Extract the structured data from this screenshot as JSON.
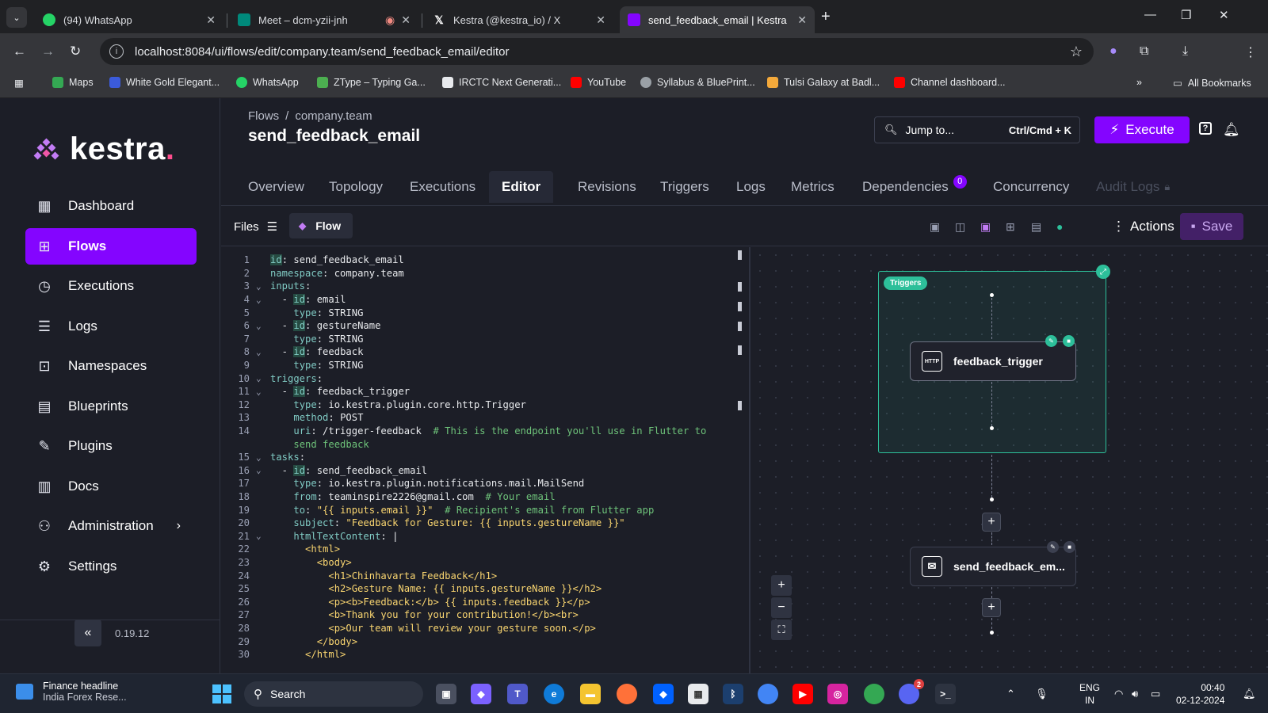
{
  "browser": {
    "tabs": [
      {
        "title": "(94) WhatsApp",
        "icon": "whatsapp-icon",
        "color": "#25d366"
      },
      {
        "title": "Meet – dcm-yzii-jnh",
        "icon": "google-meet-icon",
        "color": "#00897b"
      },
      {
        "title": "Kestra (@kestra_io) / X",
        "icon": "x-icon",
        "color": "#000000"
      },
      {
        "title": "send_feedback_email | Kestra",
        "icon": "kestra-icon",
        "color": "#8405ff"
      }
    ],
    "url": "localhost:8084/ui/flows/edit/company.team/send_feedback_email/editor",
    "bookmarks": [
      {
        "label": "Maps",
        "color": "#34a853"
      },
      {
        "label": "White Gold Elegant...",
        "color": "#3b5bdb"
      },
      {
        "label": "WhatsApp",
        "color": "#25d366"
      },
      {
        "label": "ZType – Typing Ga...",
        "color": "#4caf50"
      },
      {
        "label": "IRCTC Next Generati...",
        "color": "#e8eaed"
      },
      {
        "label": "YouTube",
        "color": "#ff0000"
      },
      {
        "label": "Syllabus & BluePrint...",
        "color": "#9aa0a6"
      },
      {
        "label": "Tulsi Galaxy at Badl...",
        "color": "#f4a93b"
      },
      {
        "label": "Channel dashboard...",
        "color": "#ff0000"
      }
    ],
    "all_bookmarks": "All Bookmarks"
  },
  "app": {
    "brand": "kestra",
    "brand_dot": ".",
    "nav": [
      {
        "label": "Dashboard",
        "icon": "dashboard-icon",
        "glyph": "▦",
        "active": false
      },
      {
        "label": "Flows",
        "icon": "flows-icon",
        "glyph": "⊞",
        "active": true
      },
      {
        "label": "Executions",
        "icon": "executions-icon",
        "glyph": "◷",
        "active": false
      },
      {
        "label": "Logs",
        "icon": "logs-icon",
        "glyph": "☰",
        "active": false
      },
      {
        "label": "Namespaces",
        "icon": "namespaces-icon",
        "glyph": "⊡",
        "active": false
      },
      {
        "label": "Blueprints",
        "icon": "blueprints-icon",
        "glyph": "▤",
        "active": false
      },
      {
        "label": "Plugins",
        "icon": "plugins-icon",
        "glyph": "✎",
        "active": false
      },
      {
        "label": "Docs",
        "icon": "docs-icon",
        "glyph": "▥",
        "active": false
      },
      {
        "label": "Administration",
        "icon": "administration-icon",
        "glyph": "⚇",
        "active": false,
        "chevron": "›"
      },
      {
        "label": "Settings",
        "icon": "settings-icon",
        "glyph": "⚙",
        "active": false
      }
    ],
    "collapse_label": "«",
    "version": "0.19.12"
  },
  "header": {
    "breadcrumb": [
      "Flows",
      "/",
      "company.team"
    ],
    "title": "send_feedback_email",
    "jump_label": "Jump to...",
    "jump_shortcut": "Ctrl/Cmd + K",
    "execute_label": "Execute"
  },
  "tabs": [
    {
      "label": "Overview",
      "state": "normal"
    },
    {
      "label": "Topology",
      "state": "normal"
    },
    {
      "label": "Executions",
      "state": "normal"
    },
    {
      "label": "Editor",
      "state": "active"
    },
    {
      "label": "Revisions",
      "state": "normal"
    },
    {
      "label": "Triggers",
      "state": "normal"
    },
    {
      "label": "Logs",
      "state": "normal"
    },
    {
      "label": "Metrics",
      "state": "normal"
    },
    {
      "label": "Dependencies",
      "state": "normal",
      "badge": "0"
    },
    {
      "label": "Concurrency",
      "state": "normal"
    },
    {
      "label": "Audit Logs",
      "state": "disabled"
    }
  ],
  "editor_toolbar": {
    "files_label": "Files",
    "flow_label": "Flow",
    "actions_label": "Actions",
    "save_label": "Save"
  },
  "code": [
    {
      "n": "1",
      "fold": "",
      "parts": [
        [
          "kid",
          "id"
        ],
        [
          "v",
          ": send_feedback_email"
        ]
      ]
    },
    {
      "n": "2",
      "fold": "",
      "parts": [
        [
          "k",
          "namespace"
        ],
        [
          "v",
          ": company.team"
        ]
      ]
    },
    {
      "n": "3",
      "fold": "⌄",
      "parts": [
        [
          "k",
          "inputs"
        ],
        [
          "v",
          ":"
        ]
      ]
    },
    {
      "n": "4",
      "fold": "⌄",
      "parts": [
        [
          "v",
          "  - "
        ],
        [
          "kid",
          "id"
        ],
        [
          "v",
          ": email"
        ]
      ]
    },
    {
      "n": "5",
      "fold": "",
      "parts": [
        [
          "v",
          "    "
        ],
        [
          "k",
          "type"
        ],
        [
          "v",
          ": STRING"
        ]
      ]
    },
    {
      "n": "6",
      "fold": "⌄",
      "parts": [
        [
          "v",
          "  - "
        ],
        [
          "kid",
          "id"
        ],
        [
          "v",
          ": gestureName"
        ]
      ]
    },
    {
      "n": "7",
      "fold": "",
      "parts": [
        [
          "v",
          "    "
        ],
        [
          "k",
          "type"
        ],
        [
          "v",
          ": STRING"
        ]
      ]
    },
    {
      "n": "8",
      "fold": "⌄",
      "parts": [
        [
          "v",
          "  - "
        ],
        [
          "kid",
          "id"
        ],
        [
          "v",
          ": feedback"
        ]
      ]
    },
    {
      "n": "9",
      "fold": "",
      "parts": [
        [
          "v",
          "    "
        ],
        [
          "k",
          "type"
        ],
        [
          "v",
          ": STRING"
        ]
      ]
    },
    {
      "n": "10",
      "fold": "⌄",
      "parts": [
        [
          "k",
          "triggers"
        ],
        [
          "v",
          ":"
        ]
      ]
    },
    {
      "n": "11",
      "fold": "⌄",
      "parts": [
        [
          "v",
          "  - "
        ],
        [
          "kid",
          "id"
        ],
        [
          "v",
          ": feedback_trigger"
        ]
      ]
    },
    {
      "n": "12",
      "fold": "",
      "parts": [
        [
          "v",
          "    "
        ],
        [
          "k",
          "type"
        ],
        [
          "v",
          ": io.kestra.plugin.core.http.Trigger"
        ]
      ]
    },
    {
      "n": "13",
      "fold": "",
      "parts": [
        [
          "v",
          "    "
        ],
        [
          "k",
          "method"
        ],
        [
          "v",
          ": POST"
        ]
      ]
    },
    {
      "n": "14",
      "fold": "",
      "parts": [
        [
          "v",
          "    "
        ],
        [
          "k",
          "uri"
        ],
        [
          "v",
          ": /trigger-feedback  "
        ],
        [
          "c",
          "# This is the endpoint you'll use in Flutter to"
        ]
      ]
    },
    {
      "n": "",
      "fold": "",
      "parts": [
        [
          "v",
          "    "
        ],
        [
          "c",
          "send feedback"
        ]
      ]
    },
    {
      "n": "15",
      "fold": "⌄",
      "parts": [
        [
          "k",
          "tasks"
        ],
        [
          "v",
          ":"
        ]
      ]
    },
    {
      "n": "16",
      "fold": "⌄",
      "parts": [
        [
          "v",
          "  - "
        ],
        [
          "kid",
          "id"
        ],
        [
          "v",
          ": send_feedback_email"
        ]
      ]
    },
    {
      "n": "17",
      "fold": "",
      "parts": [
        [
          "v",
          "    "
        ],
        [
          "k",
          "type"
        ],
        [
          "v",
          ": io.kestra.plugin.notifications.mail.MailSend"
        ]
      ]
    },
    {
      "n": "18",
      "fold": "",
      "parts": [
        [
          "v",
          "    "
        ],
        [
          "k",
          "from"
        ],
        [
          "v",
          ": teaminspire2226@gmail.com  "
        ],
        [
          "c",
          "# Your email"
        ]
      ]
    },
    {
      "n": "19",
      "fold": "",
      "parts": [
        [
          "v",
          "    "
        ],
        [
          "k",
          "to"
        ],
        [
          "v",
          ": "
        ],
        [
          "s",
          "\"{{ inputs.email }}\""
        ],
        [
          "v",
          "  "
        ],
        [
          "c",
          "# Recipient's email from Flutter app"
        ]
      ]
    },
    {
      "n": "20",
      "fold": "",
      "parts": [
        [
          "v",
          "    "
        ],
        [
          "k",
          "subject"
        ],
        [
          "v",
          ": "
        ],
        [
          "s",
          "\"Feedback for Gesture: {{ inputs.gestureName }}\""
        ]
      ]
    },
    {
      "n": "21",
      "fold": "⌄",
      "parts": [
        [
          "v",
          "    "
        ],
        [
          "k",
          "htmlTextContent"
        ],
        [
          "v",
          ": |"
        ]
      ]
    },
    {
      "n": "22",
      "fold": "",
      "parts": [
        [
          "s",
          "      <html>"
        ]
      ]
    },
    {
      "n": "23",
      "fold": "",
      "parts": [
        [
          "s",
          "        <body>"
        ]
      ]
    },
    {
      "n": "24",
      "fold": "",
      "parts": [
        [
          "s",
          "          <h1>Chinhavarta Feedback</h1>"
        ]
      ]
    },
    {
      "n": "25",
      "fold": "",
      "parts": [
        [
          "s",
          "          <h2>Gesture Name: {{ inputs.gestureName }}</h2>"
        ]
      ]
    },
    {
      "n": "26",
      "fold": "",
      "parts": [
        [
          "s",
          "          <p><b>Feedback:</b> {{ inputs.feedback }}</p>"
        ]
      ]
    },
    {
      "n": "27",
      "fold": "",
      "parts": [
        [
          "s",
          "          <b>Thank you for your contribution!</b><br>"
        ]
      ]
    },
    {
      "n": "28",
      "fold": "",
      "parts": [
        [
          "s",
          "          <p>Our team will review your gesture soon.</p>"
        ]
      ]
    },
    {
      "n": "29",
      "fold": "",
      "parts": [
        [
          "s",
          "        </body>"
        ]
      ]
    },
    {
      "n": "30",
      "fold": "",
      "parts": [
        [
          "s",
          "      </html>"
        ]
      ]
    }
  ],
  "topology": {
    "triggers_label": "Triggers",
    "trigger_node": "feedback_trigger",
    "trigger_node_icon": "HTTP",
    "task_node": "send_feedback_em...",
    "colors": {
      "trigger": "#2dbf9a",
      "accent": "#8405ff"
    }
  },
  "taskbar": {
    "news_title": "Finance headline",
    "news_sub": "India Forex Rese...",
    "search_label": "Search",
    "lang_1": "ENG",
    "lang_2": "IN",
    "time": "00:40",
    "date": "02-12-2024",
    "discord_badge": "2"
  }
}
